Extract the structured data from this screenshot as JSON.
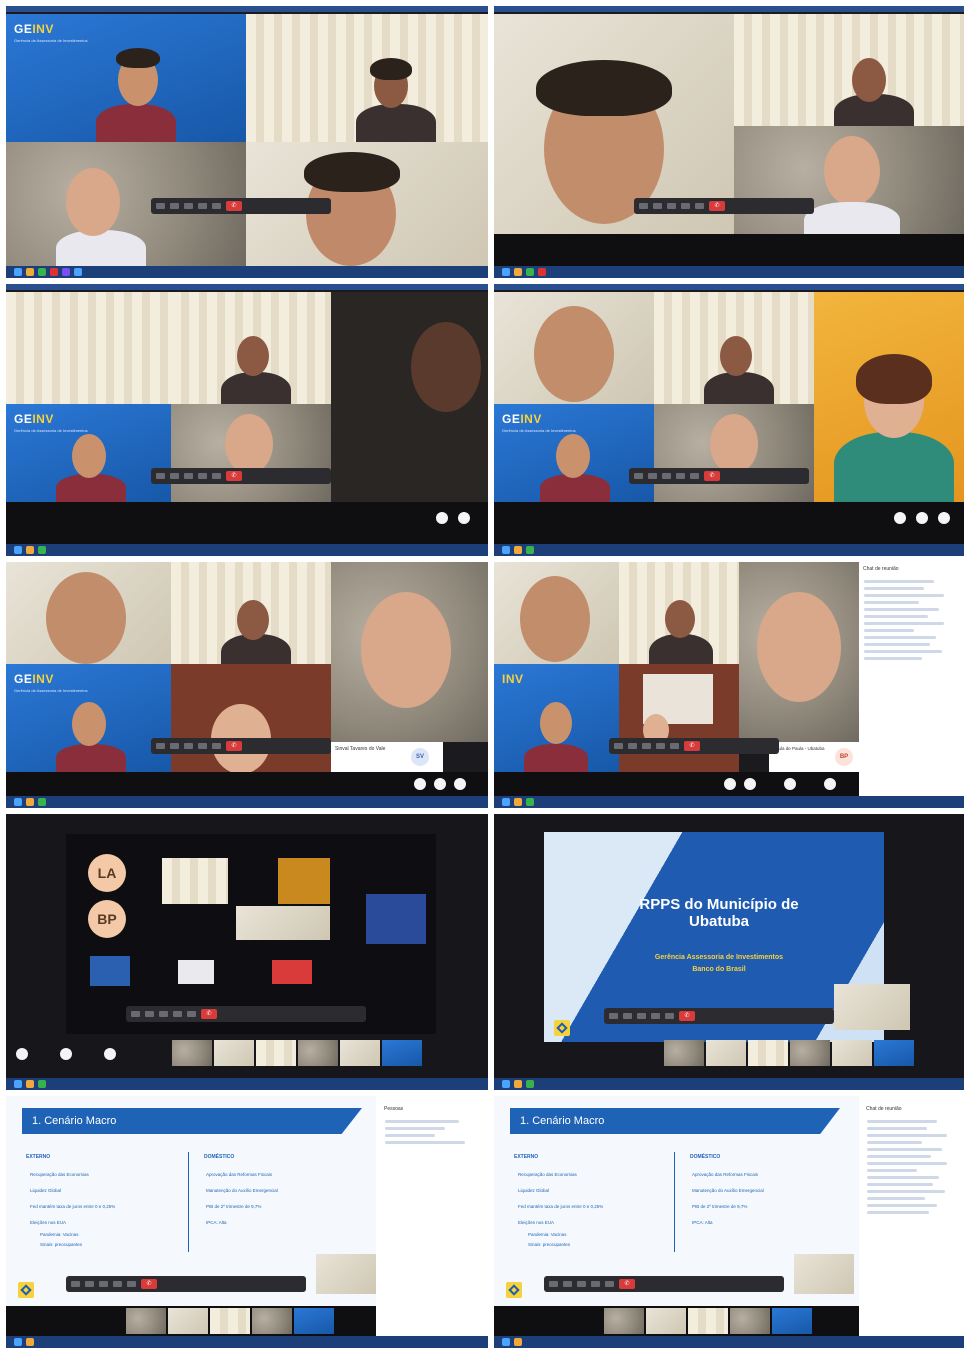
{
  "panels": [
    {
      "id": "p1",
      "banner": {
        "brand_a": "GE",
        "brand_b": "INV",
        "subtitle": "Gerência de Assessoria de Investimentos"
      }
    },
    {
      "id": "p2"
    },
    {
      "id": "p3",
      "banner": {
        "brand_a": "GE",
        "brand_b": "INV",
        "subtitle": "Gerência de Assessoria de Investimentos"
      }
    },
    {
      "id": "p4",
      "banner": {
        "brand_a": "GE",
        "brand_b": "INV",
        "subtitle": "Gerência de Assessoria de Investimentos"
      }
    },
    {
      "id": "p5",
      "banner": {
        "brand_a": "GE",
        "brand_b": "INV",
        "subtitle": "Gerência de Assessoria de Investimentos"
      },
      "tile_name": "Sinval Tavares do Vale",
      "avatar": "SV"
    },
    {
      "id": "p6",
      "banner": {
        "brand_a": "",
        "brand_b": "INV",
        "subtitle": ""
      },
      "tile_name": "Paula de Paula - Ubatuba",
      "avatar": "BP",
      "chat_title": "Chat de reunião"
    },
    {
      "id": "p7",
      "avatars": [
        "LA",
        "BP"
      ]
    },
    {
      "id": "p8",
      "slide": {
        "title": "RPPS do Município de Ubatuba",
        "subtitle": "Gerência Assessoria de Investimentos",
        "bank": "Banco do Brasil"
      }
    },
    {
      "id": "p9",
      "slide": {
        "header": "1. Cenário Macro",
        "left_title": "EXTERNO",
        "right_title": "DOMÉSTICO",
        "left_items": [
          "Recuperação das Economias",
          "Liquidez Global",
          "Fed mantém taxa de juros entre 0 e 0,25%",
          "Eleições nos EUA",
          "Pandemia: Vacinas",
          "Sinais: preocupantes"
        ],
        "right_items": [
          "Aprovação das Reformas Fiscais",
          "Manutenção do Auxílio Emergencial",
          "PIB de 2º trimestre de 9,7%",
          "IPCA: Alta"
        ]
      },
      "people_panel_title": "Pessoas"
    },
    {
      "id": "p10",
      "slide": {
        "header": "1. Cenário Macro",
        "left_title": "EXTERNO",
        "right_title": "DOMÉSTICO",
        "left_items": [
          "Recuperação das Economias",
          "Liquidez Global",
          "Fed mantém taxa de juros entre 0 e 0,25%",
          "Eleições nos EUA",
          "Pandemia: Vacinas",
          "Sinais: preocupantes"
        ],
        "right_items": [
          "Aprovação das Reformas Fiscais",
          "Manutenção do Auxílio Emergencial",
          "PIB de 2º trimestre de 9,7%",
          "IPCA: Alta"
        ]
      },
      "chat_title": "Chat de reunião"
    }
  ],
  "colors": {
    "teams_dark": "#1b1b1f",
    "brand_blue": "#1f63b7",
    "brand_yellow": "#f6d23d",
    "hangup_red": "#d93a3a"
  },
  "icons": [
    "camera-icon",
    "mic-icon",
    "share-icon",
    "chat-icon",
    "hangup-icon",
    "windows-taskbar-icon"
  ]
}
